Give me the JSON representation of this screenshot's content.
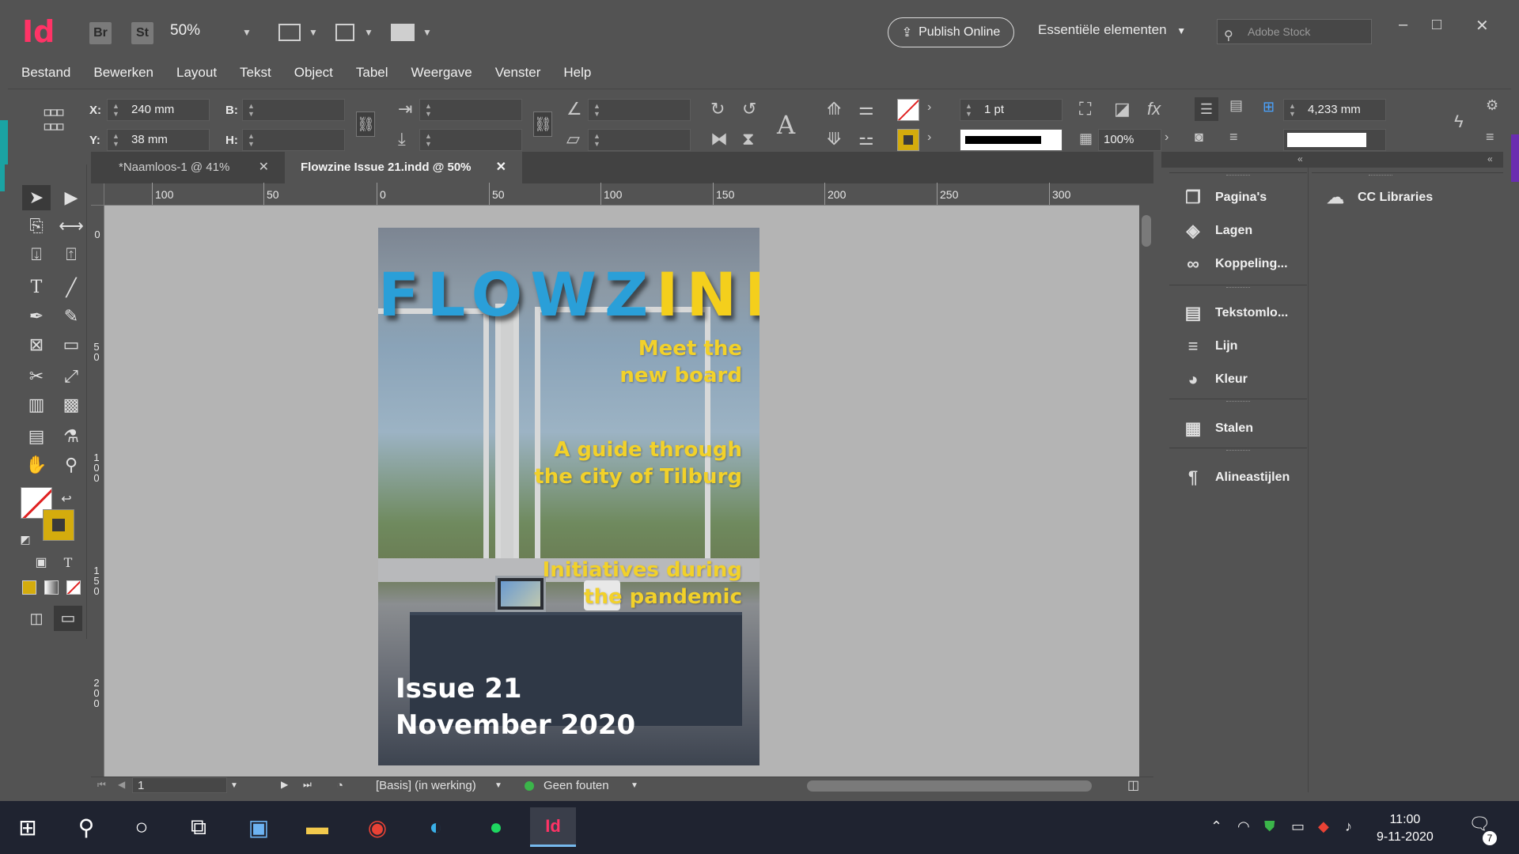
{
  "app": {
    "logo": "Id",
    "bridge": "Br",
    "stock_btn": "St",
    "zoom": "50%",
    "publish_label": "Publish Online",
    "workspace": "Essentiële elementen",
    "search_placeholder": "Adobe Stock"
  },
  "menu": [
    "Bestand",
    "Bewerken",
    "Layout",
    "Tekst",
    "Object",
    "Tabel",
    "Weergave",
    "Venster",
    "Help"
  ],
  "control": {
    "x_label": "X:",
    "x_value": "240 mm",
    "y_label": "Y:",
    "y_value": "38 mm",
    "w_label": "B:",
    "h_label": "H:",
    "stroke_weight": "1 pt",
    "opacity": "100%",
    "spacing": "4,233 mm"
  },
  "tabs": [
    {
      "label": "*Naamloos-1 @ 41%"
    },
    {
      "label": "Flowzine Issue 21.indd @ 50%"
    }
  ],
  "ruler": {
    "h": [
      "100",
      "50",
      "0",
      "50",
      "100",
      "150",
      "200",
      "250",
      "300"
    ],
    "v": [
      "0",
      "50",
      "100",
      "150",
      "200"
    ]
  },
  "cover": {
    "title_blue": "FLOWZ",
    "title_yellow": "INE",
    "headline1": [
      "Meet the",
      "new board"
    ],
    "headline2": [
      "A guide through",
      "the city of Tilburg"
    ],
    "headline3": [
      "Initiatives during",
      "the pandemic"
    ],
    "issue": "Issue 21",
    "date": "November 2020"
  },
  "status": {
    "page": "1",
    "style": "[Basis] (in werking)",
    "errors": "Geen fouten"
  },
  "panels": {
    "col1": [
      "Pagina's",
      "Lagen",
      "Koppeling...",
      "Tekstomlo...",
      "Lijn",
      "Kleur",
      "Stalen",
      "Alineastijlen"
    ],
    "col2": [
      "CC Libraries"
    ]
  },
  "taskbar": {
    "time": "11:00",
    "date": "9-11-2020",
    "notifications": "7"
  },
  "colors": {
    "accent_yellow": "#f4cf1c",
    "accent_blue": "#2a9fd8",
    "indesign_pink": "#ff3366"
  }
}
